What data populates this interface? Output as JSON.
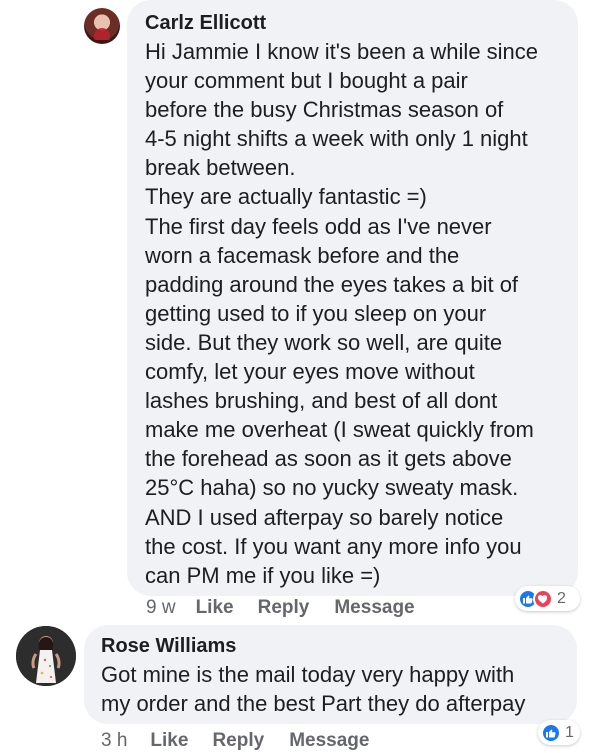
{
  "comments": [
    {
      "author": "Carlz Ellicott",
      "lines": [
        "Hi Jammie I know it's been a while since",
        "your comment but I bought a pair",
        "before the busy Christmas season of",
        "4-5 night shifts a week with only 1 night",
        "break between.",
        "They are actually fantastic =)",
        "The first day feels odd as I've never",
        "worn a facemask before and the",
        "padding around the eyes takes a bit of",
        "getting used to if you sleep on your",
        "side. But they work so well, are quite",
        "comfy, let your eyes move without",
        "lashes brushing, and best of all dont",
        "make me overheat (I sweat quickly from",
        "the forehead as soon as it gets above",
        "25°C haha) so no yucky sweaty mask.",
        "AND I used afterpay so barely notice",
        "the cost. If you want any more info you",
        "can PM me if you like =)"
      ],
      "time": "9 w",
      "actions": [
        "Like",
        "Reply",
        "Message"
      ],
      "reactions": {
        "icons": [
          "thumbs-up-icon",
          "heart-icon"
        ],
        "count": "2"
      }
    },
    {
      "author": "Rose Williams",
      "lines": [
        "Got mine is the mail today very happy with",
        "my order and the best Part they do afterpay"
      ],
      "time": "3 h",
      "actions": [
        "Like",
        "Reply",
        "Message"
      ],
      "reactions": {
        "icons": [
          "thumbs-up-icon"
        ],
        "count": "1"
      }
    }
  ],
  "colors": {
    "bubble": "#f0f2f5",
    "text": "#1c1e21",
    "secondary_text": "#65676b",
    "like": "#1877f2",
    "love": "#f33e58"
  }
}
